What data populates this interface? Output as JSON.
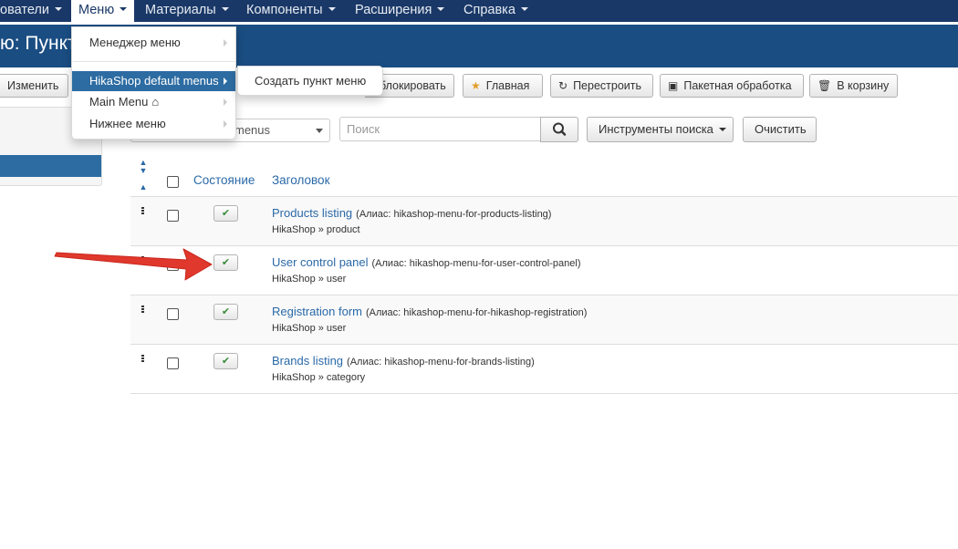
{
  "navbar": {
    "items": [
      {
        "label": "ователи"
      },
      {
        "label": "Меню"
      },
      {
        "label": "Материалы"
      },
      {
        "label": "Компоненты"
      },
      {
        "label": "Расширения"
      },
      {
        "label": "Справка"
      }
    ]
  },
  "page_title": "ю: Пункт",
  "toolbar": {
    "edit": "Изменить",
    "unlock": "блокировать",
    "home": "Главная",
    "rebuild": "Перестроить",
    "batch": "Пакетная обработка",
    "trash": "В корзину"
  },
  "filter": {
    "menu_select_value": "menus",
    "search_placeholder": "Поиск",
    "search_tools": "Инструменты поиска",
    "clear": "Очистить"
  },
  "table": {
    "headers": {
      "state": "Состояние",
      "title": "Заголовок"
    },
    "rows": [
      {
        "title": "Products listing",
        "alias": "(Алиас: hikashop-menu-for-products-listing)",
        "sub": "HikaShop » product"
      },
      {
        "title": "User control panel",
        "alias": "(Алиас: hikashop-menu-for-user-control-panel)",
        "sub": "HikaShop » user"
      },
      {
        "title": "Registration form",
        "alias": "(Алиас: hikashop-menu-for-hikashop-registration)",
        "sub": "HikaShop » user"
      },
      {
        "title": "Brands listing",
        "alias": "(Алиас: hikashop-menu-for-brands-listing)",
        "sub": "HikaShop » category"
      }
    ]
  },
  "dropdown": {
    "items": [
      {
        "label": "Менеджер меню"
      },
      {
        "label": "HikaShop default menus"
      },
      {
        "label": "Main Menu"
      },
      {
        "label": "Нижнее меню"
      }
    ],
    "submenu_item": "Создать пункт меню"
  },
  "colors": {
    "navbar": "#1a3867",
    "titlebar": "#1a4d82",
    "link": "#2a69a8",
    "highlight": "#2d6ca2",
    "annotation_arrow": "#e0382c"
  }
}
